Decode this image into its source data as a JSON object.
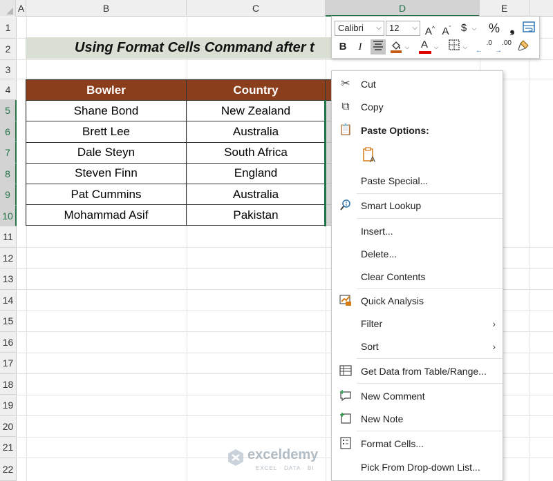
{
  "columns": [
    "A",
    "B",
    "C",
    "D",
    "E"
  ],
  "rows": [
    "1",
    "2",
    "3",
    "4",
    "5",
    "6",
    "7",
    "8",
    "9",
    "10",
    "11",
    "12",
    "13",
    "14",
    "15",
    "16",
    "17",
    "18",
    "19",
    "20",
    "21",
    "22"
  ],
  "title": "Using Format Cells Command after t",
  "table": {
    "headers": [
      "Bowler",
      "Country"
    ],
    "rows": [
      [
        "Shane Bond",
        "New Zealand"
      ],
      [
        "Brett Lee",
        "Australia"
      ],
      [
        "Dale Steyn",
        "South Africa"
      ],
      [
        "Steven Finn",
        "England"
      ],
      [
        "Pat Cummins",
        "Australia"
      ],
      [
        "Mohammad Asif",
        "Pakistan"
      ]
    ]
  },
  "toolbar": {
    "font": "Calibri",
    "font_size": "12",
    "grow_font": "A",
    "shrink_font": "A",
    "accounting_format": "$",
    "percent_format": "%",
    "comma_style": "❟",
    "bold": "B",
    "italic": "I",
    "font_color": "A",
    "decrease_decimal": ".0",
    "increase_decimal": ".00",
    "icons": {
      "wrap": "wrap-text-icon",
      "align": "center-align-icon",
      "fill": "fill-color-icon",
      "borders": "borders-icon",
      "painter": "format-painter-icon"
    }
  },
  "menu": {
    "cut": "Cut",
    "copy": "Copy",
    "paste_options": "Paste Options:",
    "paste_special": "Paste Special...",
    "smart_lookup": "Smart Lookup",
    "insert": "Insert...",
    "delete": "Delete...",
    "clear_contents": "Clear Contents",
    "quick_analysis": "Quick Analysis",
    "filter": "Filter",
    "sort": "Sort",
    "get_data": "Get Data from Table/Range...",
    "new_comment": "New Comment",
    "new_note": "New Note",
    "format_cells": "Format Cells...",
    "pick_from_list": "Pick From Drop-down List..."
  },
  "watermark": {
    "name": "exceldemy",
    "tagline": "EXCEL · DATA · BI"
  },
  "colors": {
    "header_fill": "#8b3e1c",
    "title_fill": "#d9dfd3",
    "selection": "#217346",
    "highlight_border": "#e23b3b"
  }
}
